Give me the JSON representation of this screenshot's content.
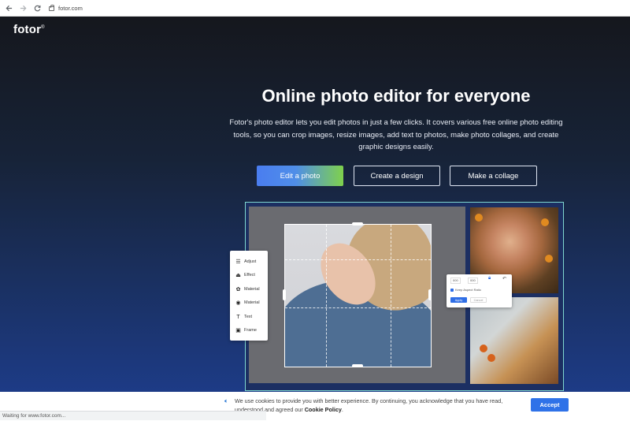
{
  "browser": {
    "url": "fotor.com"
  },
  "header": {
    "logo": "fotor",
    "logo_mark": "®"
  },
  "hero": {
    "title": "Online photo editor for everyone",
    "subtitle": "Fotor's photo editor lets you edit photos in just a few clicks. It covers various free online photo editing tools, so you can crop images, resize images, add text to photos, make photo collages, and create graphic designs easily.",
    "buttons": [
      {
        "label": "Edit a photo"
      },
      {
        "label": "Create a design"
      },
      {
        "label": "Make a collage"
      }
    ]
  },
  "editor_preview": {
    "tools": [
      "Adjust",
      "Effect",
      "Material",
      "Material",
      "Text",
      "Frame"
    ],
    "crop_panel": {
      "width": "000",
      "height": "000",
      "option": "Keep Aspect Ratio",
      "apply": "Apply",
      "cancel": "Cancel"
    }
  },
  "cookie_banner": {
    "text": "We use cookies to provide you with better experience. By continuing, you acknowledge that you have read, understood and agreed our",
    "link": "Cookie Policy",
    "end": ".",
    "accept": "Accept"
  },
  "status_bar": {
    "text": "Waiting for www.fotor.com..."
  },
  "colors": {
    "accent_blue": "#2f72e8",
    "gradient_green": "#7fd14c",
    "hero_bottom": "#1d3b86"
  }
}
